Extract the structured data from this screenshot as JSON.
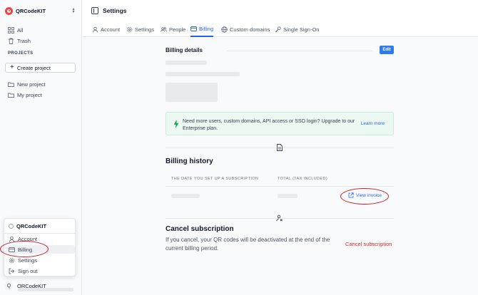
{
  "workspace": {
    "name": "QRCodeKIT"
  },
  "sidebar": {
    "items": [
      {
        "label": "All",
        "icon": "grid-icon"
      },
      {
        "label": "Trash",
        "icon": "trash-icon"
      }
    ],
    "projects_label": "PROJECTS",
    "create_project_label": "Create project",
    "projects": [
      {
        "label": "New project",
        "icon": "folder-icon"
      },
      {
        "label": "My project",
        "icon": "folder-icon"
      }
    ]
  },
  "account_menu": {
    "title": "QRCodeKIT",
    "items": [
      {
        "label": "Account",
        "icon": "user-icon"
      },
      {
        "label": "Billing",
        "icon": "credit-card-icon",
        "active": true
      },
      {
        "label": "Settings",
        "icon": "gear-icon"
      },
      {
        "label": "Sign out",
        "icon": "sign-out-icon"
      }
    ]
  },
  "user": {
    "avatar_letter": "Q",
    "name": "QRCodeKIT"
  },
  "header": {
    "title": "Settings"
  },
  "tabs": [
    {
      "label": "Account",
      "icon": "user-icon"
    },
    {
      "label": "Settings",
      "icon": "gear-icon"
    },
    {
      "label": "People",
      "icon": "people-icon"
    },
    {
      "label": "Billing",
      "icon": "credit-card-icon",
      "active": true
    },
    {
      "label": "Custom domains",
      "icon": "globe-icon"
    },
    {
      "label": "Single Sign-On",
      "icon": "key-icon"
    }
  ],
  "billing_details": {
    "title": "Billing details",
    "edit_label": "Edit"
  },
  "upgrade_banner": {
    "text": "Need more users, custom domains, API access or SSO login? Upgrade to our Enterprise plan.",
    "link_label": "Learn more"
  },
  "billing_history": {
    "title": "Billing history",
    "columns": [
      "THE DATE YOU SET UP A SUBSCRIPTION",
      "TOTAL (TAX INCLUDED)"
    ],
    "view_invoice_label": "View invoice"
  },
  "cancel_subscription": {
    "title": "Cancel subscription",
    "description": "If you cancel, your QR codes will be deactivated at the end of the current billing period.",
    "link_label": "Cancel subscription"
  },
  "colors": {
    "accent": "#2563eb",
    "danger": "#dc2626",
    "annotation": "#c81e2a",
    "success_bg": "#ecf8f2"
  }
}
